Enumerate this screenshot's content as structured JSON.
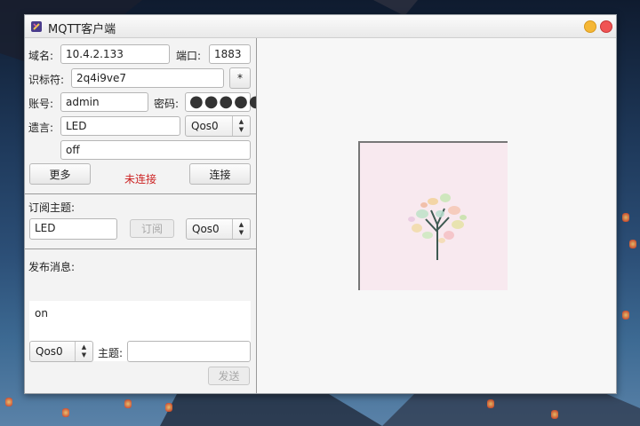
{
  "window": {
    "title": "MQTT客户端"
  },
  "connection": {
    "host_label": "域名:",
    "host_value": "10.4.2.133",
    "port_label": "端口:",
    "port_value": "1883",
    "client_id_label": "识标符:",
    "client_id_value": "2q4i9ve7",
    "generate_button": "*",
    "username_label": "账号:",
    "username_value": "admin",
    "password_label": "密码:",
    "password_mask": "●●●●●",
    "will_label": "遗言:",
    "will_topic_value": "LED",
    "will_qos": "Qos0",
    "will_message_value": "off",
    "more_button": "更多",
    "status_text": "未连接",
    "connect_button": "连接",
    "status_color": "#cc2222"
  },
  "subscribe": {
    "label": "订阅主题:",
    "topic_value": "LED",
    "button": "订阅",
    "qos": "Qos0"
  },
  "publish": {
    "label": "发布消息:",
    "message_value": "on",
    "qos": "Qos0",
    "topic_label": "主题:",
    "topic_value": "",
    "send_button": "发送"
  },
  "preview": {
    "image_desc_icon": "tree-icon"
  }
}
